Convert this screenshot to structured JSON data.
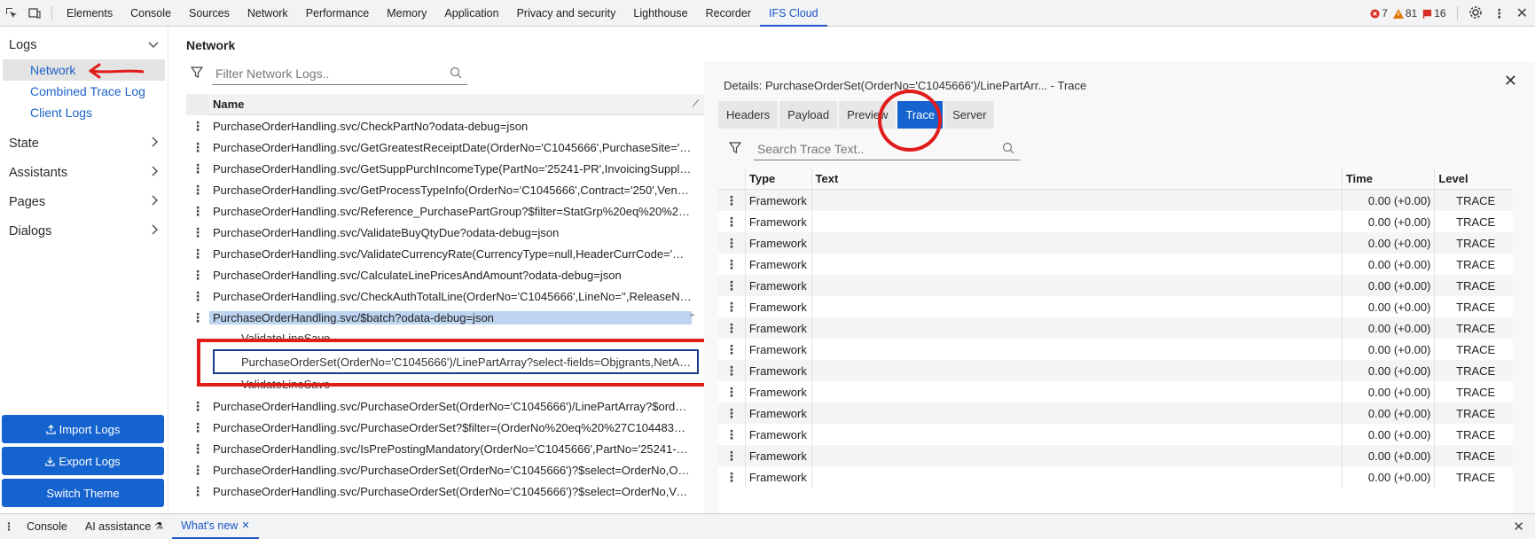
{
  "devtools": {
    "tabs": [
      "Elements",
      "Console",
      "Sources",
      "Network",
      "Performance",
      "Memory",
      "Application",
      "Privacy and security",
      "Lighthouse",
      "Recorder",
      "IFS Cloud"
    ],
    "active_tab": "IFS Cloud",
    "errors": "7",
    "warnings": "81",
    "issues": "16"
  },
  "sidebar": {
    "logs_label": "Logs",
    "logs_items": [
      "Network",
      "Combined Trace Log",
      "Client Logs"
    ],
    "sections": [
      "State",
      "Assistants",
      "Pages",
      "Dialogs"
    ],
    "import_label": "Import Logs",
    "export_label": "Export Logs",
    "theme_label": "Switch Theme"
  },
  "network": {
    "title": "Network",
    "filter_placeholder": "Filter Network Logs..",
    "column_name": "Name",
    "rows_before": [
      "PurchaseOrderHandling.svc/CheckPartNo?odata-debug=json",
      "PurchaseOrderHandling.svc/GetGreatestReceiptDate(OrderNo='C1045666',PurchaseSite='250',Bl...",
      "PurchaseOrderHandling.svc/GetSuppPurchIncomeType(PartNo='25241-PR',InvoicingSupplier='25...",
      "PurchaseOrderHandling.svc/GetProcessTypeInfo(OrderNo='C1045666',Contract='250',VendorNo...",
      "PurchaseOrderHandling.svc/Reference_PurchasePartGroup?$filter=StatGrp%20eq%20%275120...",
      "PurchaseOrderHandling.svc/ValidateBuyQtyDue?odata-debug=json",
      "PurchaseOrderHandling.svc/ValidateCurrencyRate(CurrencyType=null,HeaderCurrCode='USD',H...",
      "PurchaseOrderHandling.svc/CalculateLinePricesAndAmount?odata-debug=json",
      "PurchaseOrderHandling.svc/CheckAuthTotalLine(OrderNo='C1045666',LineNo='',ReleaseNo='',Ne..."
    ],
    "selected_row": "PurchaseOrderHandling.svc/$batch?odata-debug=json",
    "children": [
      "ValidateLineSave",
      "PurchaseOrderSet(OrderNo='C1045666')/LinePartArray?select-fields=Objgrants,NetAmtCur...",
      "ValidateLineSave"
    ],
    "rows_after": [
      "PurchaseOrderHandling.svc/PurchaseOrderSet(OrderNo='C1045666')/LinePartArray?$orderby...",
      "PurchaseOrderHandling.svc/PurchaseOrderSet?$filter=(OrderNo%20eq%20%27C1044831%27)&...",
      "PurchaseOrderHandling.svc/IsPrePostingMandatory(OrderNo='C1045666',PartNo='25241-PR',Co...",
      "PurchaseOrderHandling.svc/PurchaseOrderSet(OrderNo='C1045666')?$select=OrderNo,Objstate...",
      "PurchaseOrderHandling.svc/PurchaseOrderSet(OrderNo='C1045666')?$select=OrderNo,VendorN..."
    ]
  },
  "details": {
    "title": "Details: PurchaseOrderSet(OrderNo='C1045666')/LinePartArr...  - Trace",
    "tabs": [
      "Headers",
      "Payload",
      "Preview",
      "Trace",
      "Server"
    ],
    "active_tab": "Trace",
    "search_placeholder": "Search Trace Text..",
    "columns": {
      "type": "Type",
      "text": "Text",
      "time": "Time",
      "level": "Level"
    },
    "rows": [
      {
        "type": "Framework",
        "text": "",
        "time": "0.00 (+0.00)",
        "level": "TRACE"
      },
      {
        "type": "Framework",
        "text": "",
        "time": "0.00 (+0.00)",
        "level": "TRACE"
      },
      {
        "type": "Framework",
        "text": "",
        "time": "0.00 (+0.00)",
        "level": "TRACE"
      },
      {
        "type": "Framework",
        "text": "",
        "time": "0.00 (+0.00)",
        "level": "TRACE"
      },
      {
        "type": "Framework",
        "text": "",
        "time": "0.00 (+0.00)",
        "level": "TRACE"
      },
      {
        "type": "Framework",
        "text": "",
        "time": "0.00 (+0.00)",
        "level": "TRACE"
      },
      {
        "type": "Framework",
        "text": "",
        "time": "0.00 (+0.00)",
        "level": "TRACE"
      },
      {
        "type": "Framework",
        "text": "",
        "time": "0.00 (+0.00)",
        "level": "TRACE"
      },
      {
        "type": "Framework",
        "text": "",
        "time": "0.00 (+0.00)",
        "level": "TRACE"
      },
      {
        "type": "Framework",
        "text": "",
        "time": "0.00 (+0.00)",
        "level": "TRACE"
      },
      {
        "type": "Framework",
        "text": "",
        "time": "0.00 (+0.00)",
        "level": "TRACE"
      },
      {
        "type": "Framework",
        "text": "",
        "time": "0.00 (+0.00)",
        "level": "TRACE"
      },
      {
        "type": "Framework",
        "text": "",
        "time": "0.00 (+0.00)",
        "level": "TRACE"
      },
      {
        "type": "Framework",
        "text": "",
        "time": "0.00 (+0.00)",
        "level": "TRACE"
      }
    ]
  },
  "drawer": {
    "tabs": [
      "Console",
      "AI assistance",
      "What's new"
    ],
    "active_tab": "What's new"
  },
  "colors": {
    "accent": "#1563cf",
    "annotation_red": "#e21b1b",
    "selected_row": "#bcd4f0"
  }
}
